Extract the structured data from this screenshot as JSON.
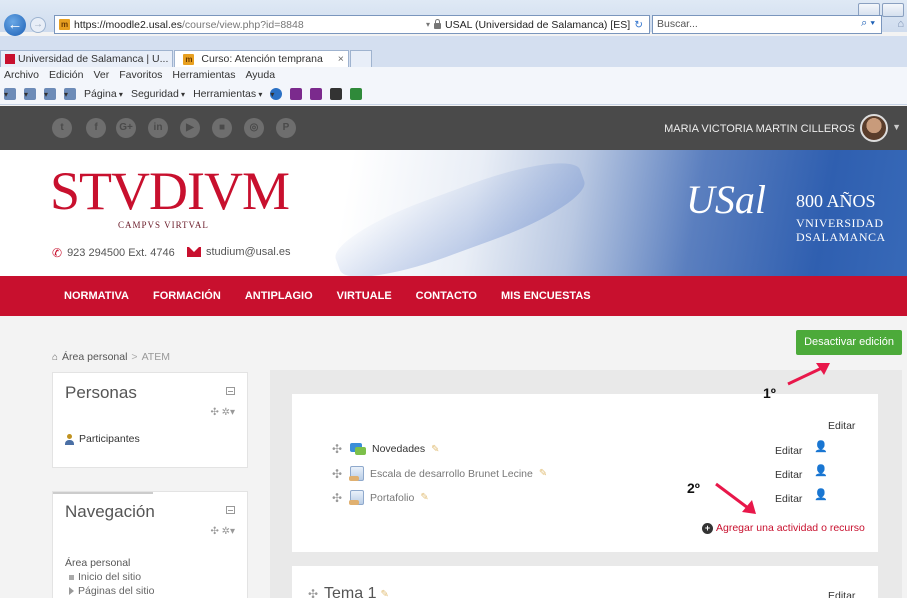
{
  "browser": {
    "url_host": "https://moodle2.usal.es",
    "url_path": "/course/view.php?id=8848",
    "security_label": "USAL (Universidad de Salamanca) [ES]",
    "search_placeholder": "Buscar...",
    "tabs": [
      {
        "label": "Universidad de Salamanca | U..."
      },
      {
        "label": "Curso: Atención temprana"
      }
    ],
    "menu": [
      "Archivo",
      "Edición",
      "Ver",
      "Favoritos",
      "Herramientas",
      "Ayuda"
    ],
    "commands": [
      "Página",
      "Seguridad",
      "Herramientas"
    ]
  },
  "social": {
    "icons": [
      "twitter-icon",
      "facebook-icon",
      "googleplus-icon",
      "linkedin-icon",
      "youtube-icon",
      "flickr-icon",
      "instagram-icon",
      "pinterest-icon"
    ],
    "glyphs": [
      "t",
      "f",
      "G+",
      "in",
      "▶",
      "■",
      "◎",
      "P"
    ],
    "user_name": "MARIA VICTORIA MARTIN CILLEROS"
  },
  "header": {
    "logo": "STVDIVM",
    "logo_sub": "CAMPVS VIRTVAL",
    "phone": "923 294500 Ext. 4746",
    "email": "studium@usal.es",
    "usal_logo": "USal",
    "anniversary": "800 AÑOS",
    "univ_line1": "VNIVERSIDAD",
    "univ_line2": "DSALAMANCA"
  },
  "nav": [
    "NORMATIVA",
    "FORMACIÓN",
    "ANTIPLAGIO",
    "VIRTUALE",
    "CONTACTO",
    "MIS ENCUESTAS"
  ],
  "page": {
    "edit_button": "Desactivar edición",
    "breadcrumb": {
      "home": "Área personal",
      "current": "ATEM"
    }
  },
  "blocks": {
    "personas": {
      "title": "Personas",
      "item": "Participantes"
    },
    "navegacion": {
      "title": "Navegación",
      "items": [
        "Área personal",
        "Inicio del sitio",
        "Páginas del sitio"
      ]
    }
  },
  "section0": {
    "edit_label": "Editar",
    "activities": [
      {
        "name": "Novedades",
        "edit": "Editar"
      },
      {
        "name": "Escala de desarrollo Brunet Lecine",
        "edit": "Editar"
      },
      {
        "name": "Portafolio",
        "edit": "Editar"
      }
    ],
    "add_resource": "Agregar una actividad o recurso"
  },
  "section1": {
    "title": "Tema 1",
    "edit_label": "Editar"
  },
  "annotations": {
    "first": "1º",
    "second": "2º",
    "arrow_color": "#e8174a"
  },
  "colors": {
    "brand_red": "#c8102e",
    "edit_green": "#4caa3a",
    "social_bar": "#4a4a4a"
  }
}
